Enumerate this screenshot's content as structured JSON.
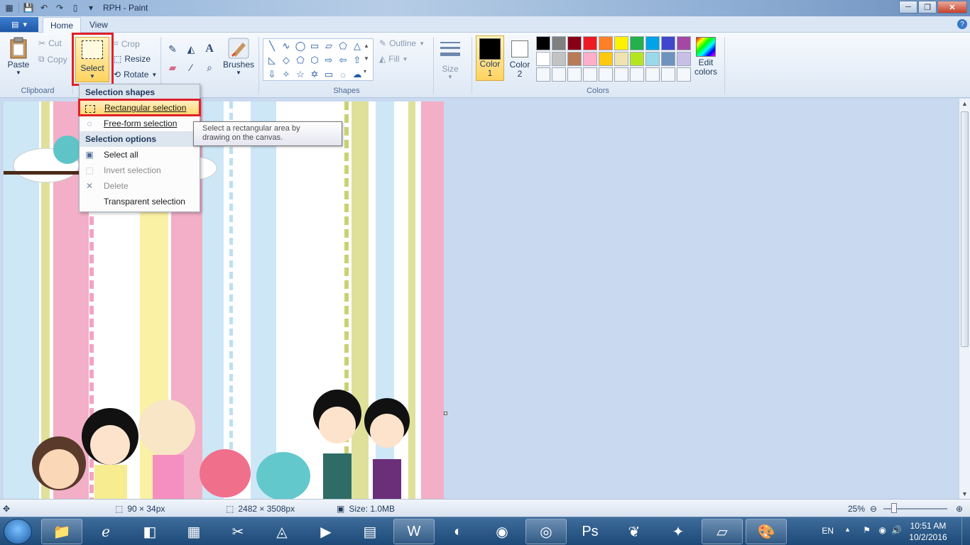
{
  "window": {
    "title": "RPH - Paint"
  },
  "tabs": {
    "home": "Home",
    "view": "View"
  },
  "clipboard": {
    "paste": "Paste",
    "cut": "Cut",
    "copy": "Copy",
    "label": "Clipboard"
  },
  "image": {
    "select": "Select",
    "crop": "Crop",
    "resize": "Resize",
    "rotate": "Rotate"
  },
  "tools": {
    "brushes": "Brushes"
  },
  "shapes": {
    "outline": "Outline",
    "fill": "Fill",
    "label": "Shapes"
  },
  "size": {
    "label": "Size"
  },
  "colors": {
    "color1": "Color 1",
    "color2": "Color 2",
    "edit": "Edit colors",
    "label": "Colors",
    "color1_value": "#000000",
    "color2_value": "#ffffff",
    "palette": [
      "#000000",
      "#7f7f7f",
      "#880015",
      "#ed1c24",
      "#ff7f27",
      "#fff200",
      "#22b14c",
      "#00a2e8",
      "#3f48cc",
      "#a349a4",
      "#ffffff",
      "#c3c3c3",
      "#b97a57",
      "#ffaec9",
      "#ffc90e",
      "#efe4b0",
      "#b5e61d",
      "#99d9ea",
      "#7092be",
      "#c8bfe7"
    ]
  },
  "select_menu": {
    "header_shapes": "Selection shapes",
    "rectangular": "Rectangular selection",
    "freeform": "Free-form selection",
    "header_options": "Selection options",
    "select_all": "Select all",
    "invert": "Invert selection",
    "delete": "Delete",
    "transparent": "Transparent selection"
  },
  "tooltip": {
    "line1": "Select a rectangular area by",
    "line2": "drawing on the canvas."
  },
  "statusbar": {
    "selection_size": "90 × 34px",
    "image_size": "2482 × 3508px",
    "file_size": "Size: 1.0MB",
    "zoom": "25%"
  },
  "taskbar": {
    "language": "EN",
    "time": "10:51 AM",
    "date": "10/2/2016"
  },
  "accent": "#ffd35f",
  "highlight_border": "#e0202a"
}
